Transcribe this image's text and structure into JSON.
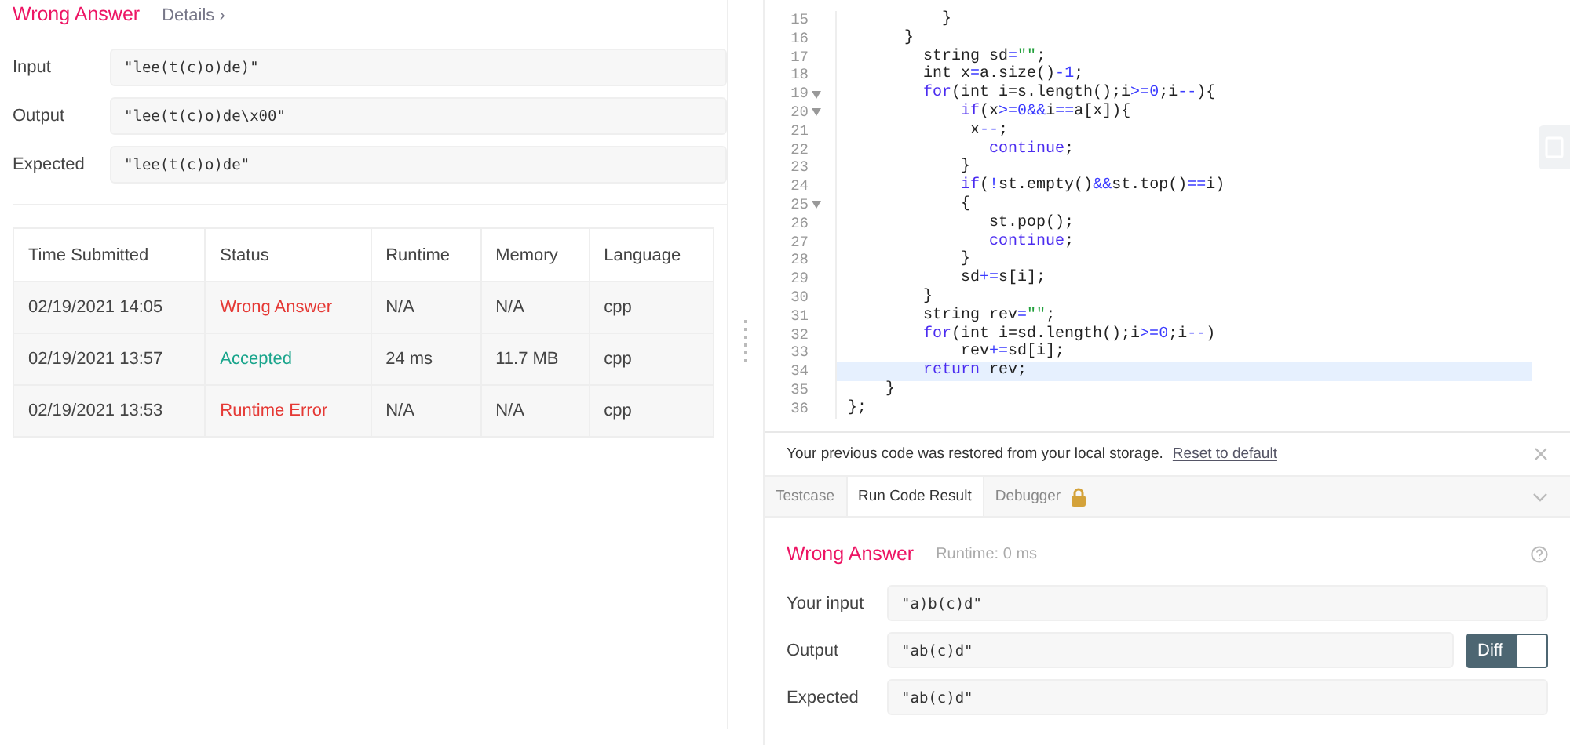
{
  "left": {
    "verdict": "Wrong Answer",
    "details_link": "Details ›",
    "fields": [
      {
        "label": "Input",
        "value": "\"lee(t(c)o)de)\""
      },
      {
        "label": "Output",
        "value": "\"lee(t(c)o)de\\x00\""
      },
      {
        "label": "Expected",
        "value": "\"lee(t(c)o)de\""
      }
    ],
    "table": {
      "columns": [
        "Time Submitted",
        "Status",
        "Runtime",
        "Memory",
        "Language"
      ],
      "rows": [
        {
          "time": "02/19/2021 14:05",
          "status": "Wrong Answer",
          "color": "#e53935",
          "runtime": "N/A",
          "memory": "N/A",
          "language": "cpp"
        },
        {
          "time": "02/19/2021 13:57",
          "status": "Accepted",
          "color": "#1aa58c",
          "runtime": "24 ms",
          "memory": "11.7 MB",
          "language": "cpp"
        },
        {
          "time": "02/19/2021 13:53",
          "status": "Runtime Error",
          "color": "#e53935",
          "runtime": "N/A",
          "memory": "N/A",
          "language": "cpp"
        }
      ]
    }
  },
  "editor": {
    "lines": [
      {
        "number": "15",
        "foldable": false,
        "highlighted": false,
        "tokens": [
          {
            "kind": "plain",
            "text": "          }"
          }
        ]
      },
      {
        "number": "16",
        "foldable": false,
        "highlighted": false,
        "tokens": [
          {
            "kind": "plain",
            "text": "      }"
          }
        ]
      },
      {
        "number": "17",
        "foldable": false,
        "highlighted": false,
        "tokens": [
          {
            "kind": "plain",
            "text": "        string sd"
          },
          {
            "kind": "op",
            "text": "="
          },
          {
            "kind": "string",
            "text": "\"\""
          },
          {
            "kind": "plain",
            "text": ";"
          }
        ]
      },
      {
        "number": "18",
        "foldable": false,
        "highlighted": false,
        "tokens": [
          {
            "kind": "plain",
            "text": "        int x"
          },
          {
            "kind": "op",
            "text": "="
          },
          {
            "kind": "plain",
            "text": "a.size()"
          },
          {
            "kind": "op",
            "text": "-"
          },
          {
            "kind": "number",
            "text": "1"
          },
          {
            "kind": "plain",
            "text": ";"
          }
        ]
      },
      {
        "number": "19",
        "foldable": true,
        "highlighted": false,
        "tokens": [
          {
            "kind": "keyword",
            "text": "        for"
          },
          {
            "kind": "plain",
            "text": "(int i=s.length();i"
          },
          {
            "kind": "op",
            "text": ">="
          },
          {
            "kind": "number",
            "text": "0"
          },
          {
            "kind": "plain",
            "text": ";i"
          },
          {
            "kind": "op",
            "text": "--"
          },
          {
            "kind": "plain",
            "text": "){"
          }
        ]
      },
      {
        "number": "20",
        "foldable": true,
        "highlighted": false,
        "tokens": [
          {
            "kind": "keyword",
            "text": "            if"
          },
          {
            "kind": "plain",
            "text": "(x"
          },
          {
            "kind": "op",
            "text": ">="
          },
          {
            "kind": "number",
            "text": "0"
          },
          {
            "kind": "op",
            "text": "&&"
          },
          {
            "kind": "plain",
            "text": "i"
          },
          {
            "kind": "op",
            "text": "=="
          },
          {
            "kind": "plain",
            "text": "a[x]){"
          }
        ]
      },
      {
        "number": "21",
        "foldable": false,
        "highlighted": false,
        "tokens": [
          {
            "kind": "plain",
            "text": "             x"
          },
          {
            "kind": "op",
            "text": "--"
          },
          {
            "kind": "plain",
            "text": ";"
          }
        ]
      },
      {
        "number": "22",
        "foldable": false,
        "highlighted": false,
        "tokens": [
          {
            "kind": "keyword",
            "text": "               continue"
          },
          {
            "kind": "plain",
            "text": ";"
          }
        ]
      },
      {
        "number": "23",
        "foldable": false,
        "highlighted": false,
        "tokens": [
          {
            "kind": "plain",
            "text": "            }"
          }
        ]
      },
      {
        "number": "24",
        "foldable": false,
        "highlighted": false,
        "tokens": [
          {
            "kind": "keyword",
            "text": "            if"
          },
          {
            "kind": "plain",
            "text": "("
          },
          {
            "kind": "op",
            "text": "!"
          },
          {
            "kind": "plain",
            "text": "st.empty()"
          },
          {
            "kind": "op",
            "text": "&&"
          },
          {
            "kind": "plain",
            "text": "st.top()"
          },
          {
            "kind": "op",
            "text": "=="
          },
          {
            "kind": "plain",
            "text": "i)"
          }
        ]
      },
      {
        "number": "25",
        "foldable": true,
        "highlighted": false,
        "tokens": [
          {
            "kind": "plain",
            "text": "            {"
          }
        ]
      },
      {
        "number": "26",
        "foldable": false,
        "highlighted": false,
        "tokens": [
          {
            "kind": "plain",
            "text": "               st.pop();"
          }
        ]
      },
      {
        "number": "27",
        "foldable": false,
        "highlighted": false,
        "tokens": [
          {
            "kind": "keyword",
            "text": "               continue"
          },
          {
            "kind": "plain",
            "text": ";"
          }
        ]
      },
      {
        "number": "28",
        "foldable": false,
        "highlighted": false,
        "tokens": [
          {
            "kind": "plain",
            "text": "            }"
          }
        ]
      },
      {
        "number": "29",
        "foldable": false,
        "highlighted": false,
        "tokens": [
          {
            "kind": "plain",
            "text": "            sd"
          },
          {
            "kind": "op",
            "text": "+="
          },
          {
            "kind": "plain",
            "text": "s[i];"
          }
        ]
      },
      {
        "number": "30",
        "foldable": false,
        "highlighted": false,
        "tokens": [
          {
            "kind": "plain",
            "text": "        }"
          }
        ]
      },
      {
        "number": "31",
        "foldable": false,
        "highlighted": false,
        "tokens": [
          {
            "kind": "plain",
            "text": "        string rev"
          },
          {
            "kind": "op",
            "text": "="
          },
          {
            "kind": "string",
            "text": "\"\""
          },
          {
            "kind": "plain",
            "text": ";"
          }
        ]
      },
      {
        "number": "32",
        "foldable": false,
        "highlighted": false,
        "tokens": [
          {
            "kind": "keyword",
            "text": "        for"
          },
          {
            "kind": "plain",
            "text": "(int i=sd.length();i"
          },
          {
            "kind": "op",
            "text": ">="
          },
          {
            "kind": "number",
            "text": "0"
          },
          {
            "kind": "plain",
            "text": ";i"
          },
          {
            "kind": "op",
            "text": "--"
          },
          {
            "kind": "plain",
            "text": ")"
          }
        ]
      },
      {
        "number": "33",
        "foldable": false,
        "highlighted": false,
        "tokens": [
          {
            "kind": "plain",
            "text": "            rev"
          },
          {
            "kind": "op",
            "text": "+="
          },
          {
            "kind": "plain",
            "text": "sd[i];"
          }
        ]
      },
      {
        "number": "34",
        "foldable": false,
        "highlighted": true,
        "tokens": [
          {
            "kind": "keyword",
            "text": "        return"
          },
          {
            "kind": "plain",
            "text": " rev;"
          }
        ]
      },
      {
        "number": "35",
        "foldable": false,
        "highlighted": false,
        "tokens": [
          {
            "kind": "plain",
            "text": "    }"
          }
        ]
      },
      {
        "number": "36",
        "foldable": false,
        "highlighted": false,
        "tokens": [
          {
            "kind": "plain",
            "text": "};"
          }
        ]
      }
    ]
  },
  "notice": {
    "text": "Your previous code was restored from your local storage.",
    "link": "Reset to default"
  },
  "tabs": [
    {
      "label": "Testcase",
      "selected": false,
      "locked": false
    },
    {
      "label": "Run Code Result",
      "selected": true,
      "locked": false
    },
    {
      "label": "Debugger",
      "selected": false,
      "locked": true
    }
  ],
  "result": {
    "verdict": "Wrong Answer",
    "runtime": "Runtime: 0 ms",
    "fields": [
      {
        "label": "Your input",
        "value": "\"a)b(c)d\""
      },
      {
        "label": "Output",
        "value": "\"ab(c)d\"",
        "diff": {
          "label": "Diff",
          "on": true
        }
      },
      {
        "label": "Expected",
        "value": "\"ab(c)d\""
      }
    ]
  }
}
